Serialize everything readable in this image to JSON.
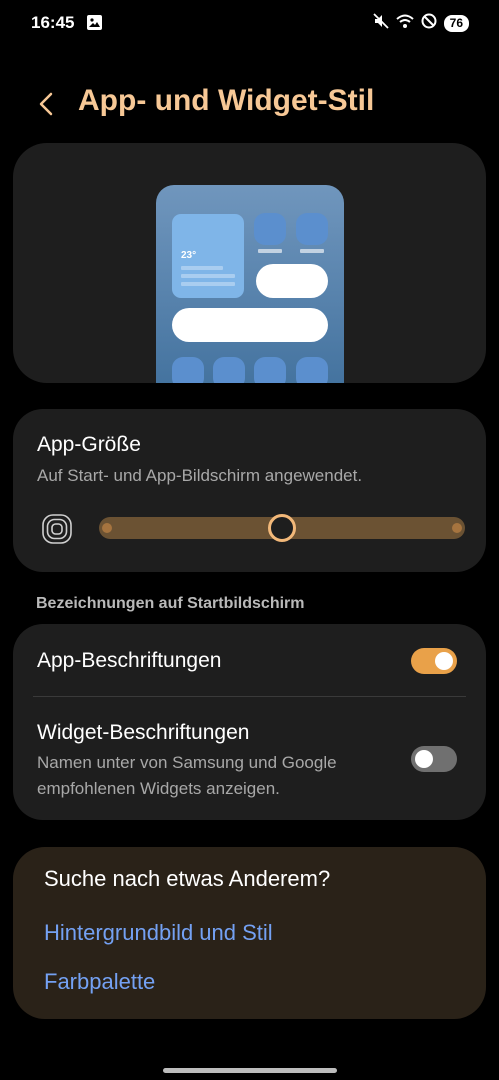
{
  "status_bar": {
    "time": "16:45",
    "battery": "76",
    "icons": [
      "gallery-icon",
      "mute-icon",
      "wifi-icon",
      "do-not-disturb-icon",
      "battery-icon"
    ]
  },
  "header": {
    "title": "App- und Widget-Stil"
  },
  "preview": {
    "weather_temp": "23°"
  },
  "app_size": {
    "title": "App-Größe",
    "subtitle": "Auf Start- und App-Bildschirm angewendet.",
    "slider_steps": 5,
    "slider_selected_index": 2
  },
  "labels_section": {
    "header": "Bezeichnungen auf Startbildschirm",
    "app_labels": {
      "title": "App-Beschriftungen",
      "enabled": true
    },
    "widget_labels": {
      "title": "Widget-Beschriftungen",
      "subtitle": "Namen unter von Samsung und Google empfohlenen Widgets anzeigen.",
      "enabled": false
    }
  },
  "suggestions": {
    "title": "Suche nach etwas Anderem?",
    "links": [
      "Hintergrundbild und Stil",
      "Farbpalette"
    ]
  },
  "colors": {
    "accent": "#f7c896",
    "toggle_on": "#e9a149",
    "link": "#74a1f3",
    "background": "#000000",
    "card": "#1e1e1e"
  }
}
